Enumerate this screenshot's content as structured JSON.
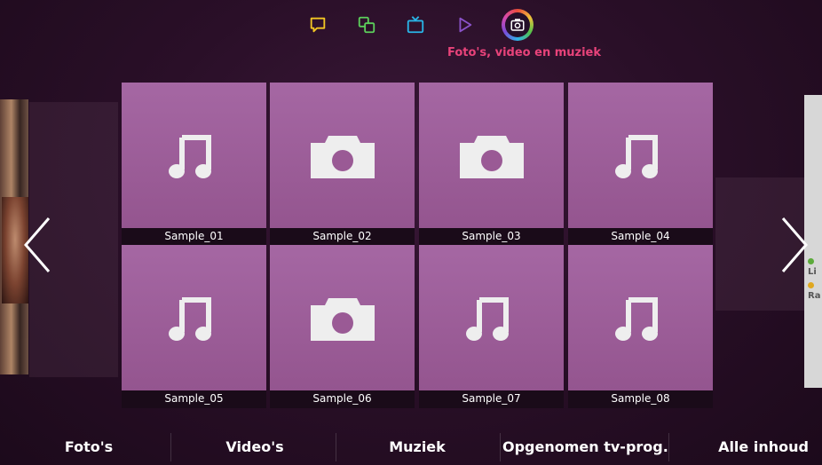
{
  "top_bar": {
    "icons": [
      {
        "name": "speech-bubble-icon",
        "color": "#f3c623"
      },
      {
        "name": "screens-icon",
        "color": "#5ccf5b"
      },
      {
        "name": "tv-icon",
        "color": "#29b6e8"
      },
      {
        "name": "play-icon",
        "color": "#8a52c9"
      },
      {
        "name": "camera-icon",
        "color": "#ffffff",
        "active": true
      }
    ],
    "section_title": "Foto's, video en muziek"
  },
  "tiles": [
    {
      "label": "Sample_01",
      "type": "music"
    },
    {
      "label": "Sample_02",
      "type": "photo"
    },
    {
      "label": "Sample_03",
      "type": "photo"
    },
    {
      "label": "Sample_04",
      "type": "music"
    },
    {
      "label": "Sample_05",
      "type": "music"
    },
    {
      "label": "Sample_06",
      "type": "photo"
    },
    {
      "label": "Sample_07",
      "type": "music"
    },
    {
      "label": "Sample_08",
      "type": "music"
    }
  ],
  "right_panel": {
    "item1": "Li",
    "item2": "Ra"
  },
  "bottom_nav": [
    "Foto's",
    "Video's",
    "Muziek",
    "Opgenomen tv-prog.",
    "Alle inhoud"
  ],
  "colors": {
    "accent": "#e8437a",
    "tile": "#a567a3",
    "background": "#2a0f28"
  }
}
